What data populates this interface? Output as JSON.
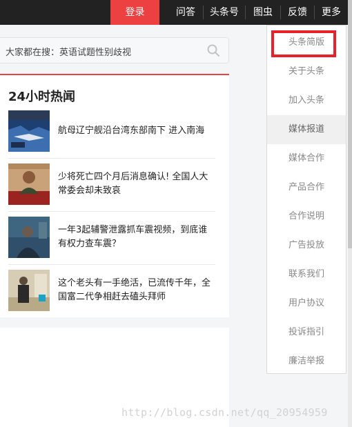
{
  "topbar": {
    "login": "登录",
    "nav": [
      "问答",
      "头条号",
      "图虫",
      "反馈",
      "更多"
    ]
  },
  "search": {
    "text": "大家都在搜：英语试题性别歧视"
  },
  "hot": {
    "title": "24小时热闻",
    "items": [
      {
        "text": "航母辽宁舰沿台湾东部南下 进入南海"
      },
      {
        "text": "少将死亡四个月后消息确认! 全国人大常委会却未致哀"
      },
      {
        "text": "一年3起辅警泄露抓车震视频，到底谁有权力查车震？"
      },
      {
        "text": "这个老头有一手绝活，已流传千年，全国富二代争相赶去磕头拜师"
      }
    ]
  },
  "dropdown": {
    "items": [
      "头条简版",
      "关于头条",
      "加入头条",
      "媒体报道",
      "媒体合作",
      "产品合作",
      "合作说明",
      "广告投放",
      "联系我们",
      "用户协议",
      "投诉指引",
      "廉洁举报"
    ],
    "hover_index": 3,
    "highlighted_index": 0
  },
  "watermark": "http://blog.csdn.net/qq_20954959",
  "colors": {
    "accent": "#ed4040",
    "topbar": "#222222",
    "highlight_box": "#e8202a"
  }
}
